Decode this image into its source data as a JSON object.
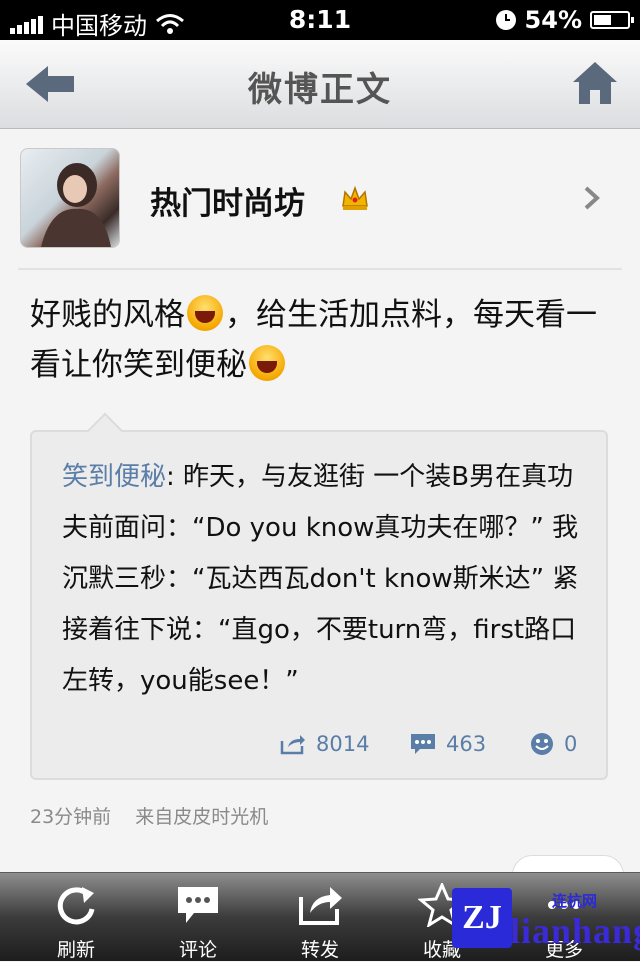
{
  "status_bar": {
    "carrier": "中国移动",
    "time": "8:11",
    "battery": "54%",
    "battery_level": 0.54
  },
  "nav": {
    "title": "微博正文"
  },
  "user": {
    "name": "热门时尚坊"
  },
  "post": {
    "text_1": "好贱的风格",
    "text_2": "，给生活加点料，每天看一看让你笑到便秘"
  },
  "retweet": {
    "author": "笑到便秘",
    "text": ": 昨天，与友逛街 一个装B男在真功夫前面问：“Do you know真功夫在哪？” 我沉默三秒：“瓦达西瓦don't know斯米达” 紧接着往下说：“直go，不要turn弯，first路口左转，you能see！”",
    "reposts": "8014",
    "comments": "463",
    "likes": "0"
  },
  "meta": {
    "time": "23分钟前",
    "source": "来自皮皮时光机"
  },
  "tabs": [
    {
      "label": "刷新",
      "icon": "refresh-icon"
    },
    {
      "label": "评论",
      "icon": "comment-icon"
    },
    {
      "label": "转发",
      "icon": "share-icon"
    },
    {
      "label": "收藏",
      "icon": "star-icon"
    },
    {
      "label": "更多",
      "icon": "more-icon"
    }
  ],
  "watermark": {
    "logo": "ZJ",
    "text": "lianhang",
    "small": "连杭网"
  },
  "colors": {
    "link": "#5a7ea8",
    "tabbar": "#2b2b2b"
  }
}
